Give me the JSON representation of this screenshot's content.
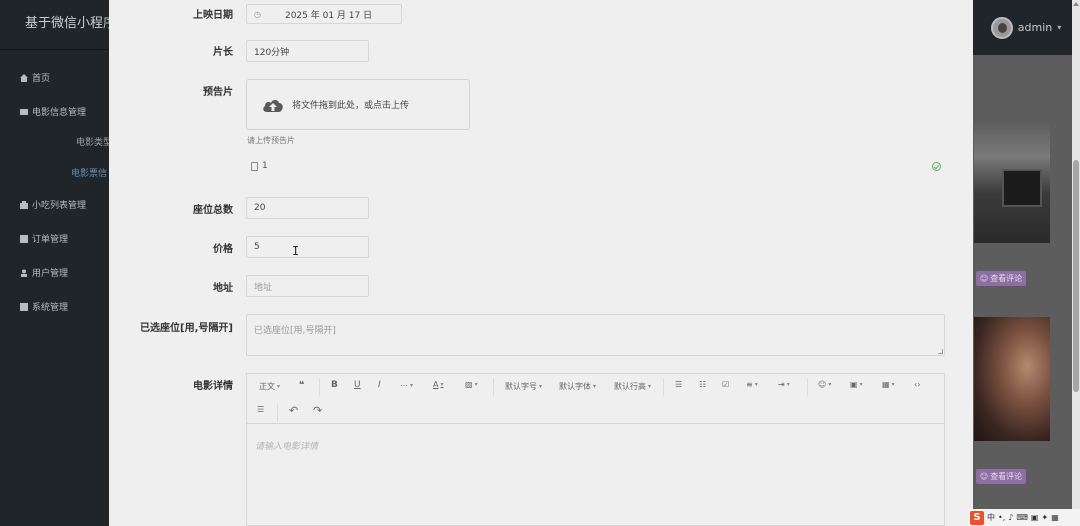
{
  "sidebar": {
    "brand": "基于微信小程序",
    "items": [
      {
        "label": "首页",
        "icon": "home-icon"
      },
      {
        "label": "电影信息管理",
        "icon": "film-icon"
      },
      {
        "label": "电影类型",
        "icon": ""
      },
      {
        "label": "电影票信",
        "icon": ""
      },
      {
        "label": "小吃列表管理",
        "icon": "snack-icon"
      },
      {
        "label": "订单管理",
        "icon": "order-icon"
      },
      {
        "label": "用户管理",
        "icon": "user-icon"
      },
      {
        "label": "系统管理",
        "icon": "settings-icon"
      }
    ]
  },
  "header": {
    "user": "admin"
  },
  "background": {
    "review_label": "查看评论"
  },
  "form": {
    "release_date_label": "上映日期",
    "release_date_value": "2025 年 01 月 17 日",
    "duration_label": "片长",
    "duration_value": "120分钟",
    "trailer_label": "预告片",
    "upload_text": "将文件拖到此处，或点击上传",
    "upload_hint": "请上传预告片",
    "uploaded_file": "1",
    "seats_label": "座位总数",
    "seats_value": "20",
    "price_label": "价格",
    "price_value": "5",
    "address_label": "地址",
    "address_placeholder": "地址",
    "selected_seats_label": "已选座位[用,号隔开]",
    "selected_seats_placeholder": "已选座位[用,号隔开]",
    "details_label": "电影详情",
    "details_placeholder": "请输入电影详情"
  },
  "editor_toolbar": {
    "paragraph": "正文",
    "font_size": "默认字号",
    "font_family": "默认字体",
    "line_height": "默认行高"
  },
  "taskbar": {
    "ime": "中"
  },
  "colors": {
    "sidebar_bg": "#1f2529",
    "dialog_bg": "#efefef",
    "review_button": "#8e6fa3",
    "success": "#5cb85c"
  }
}
